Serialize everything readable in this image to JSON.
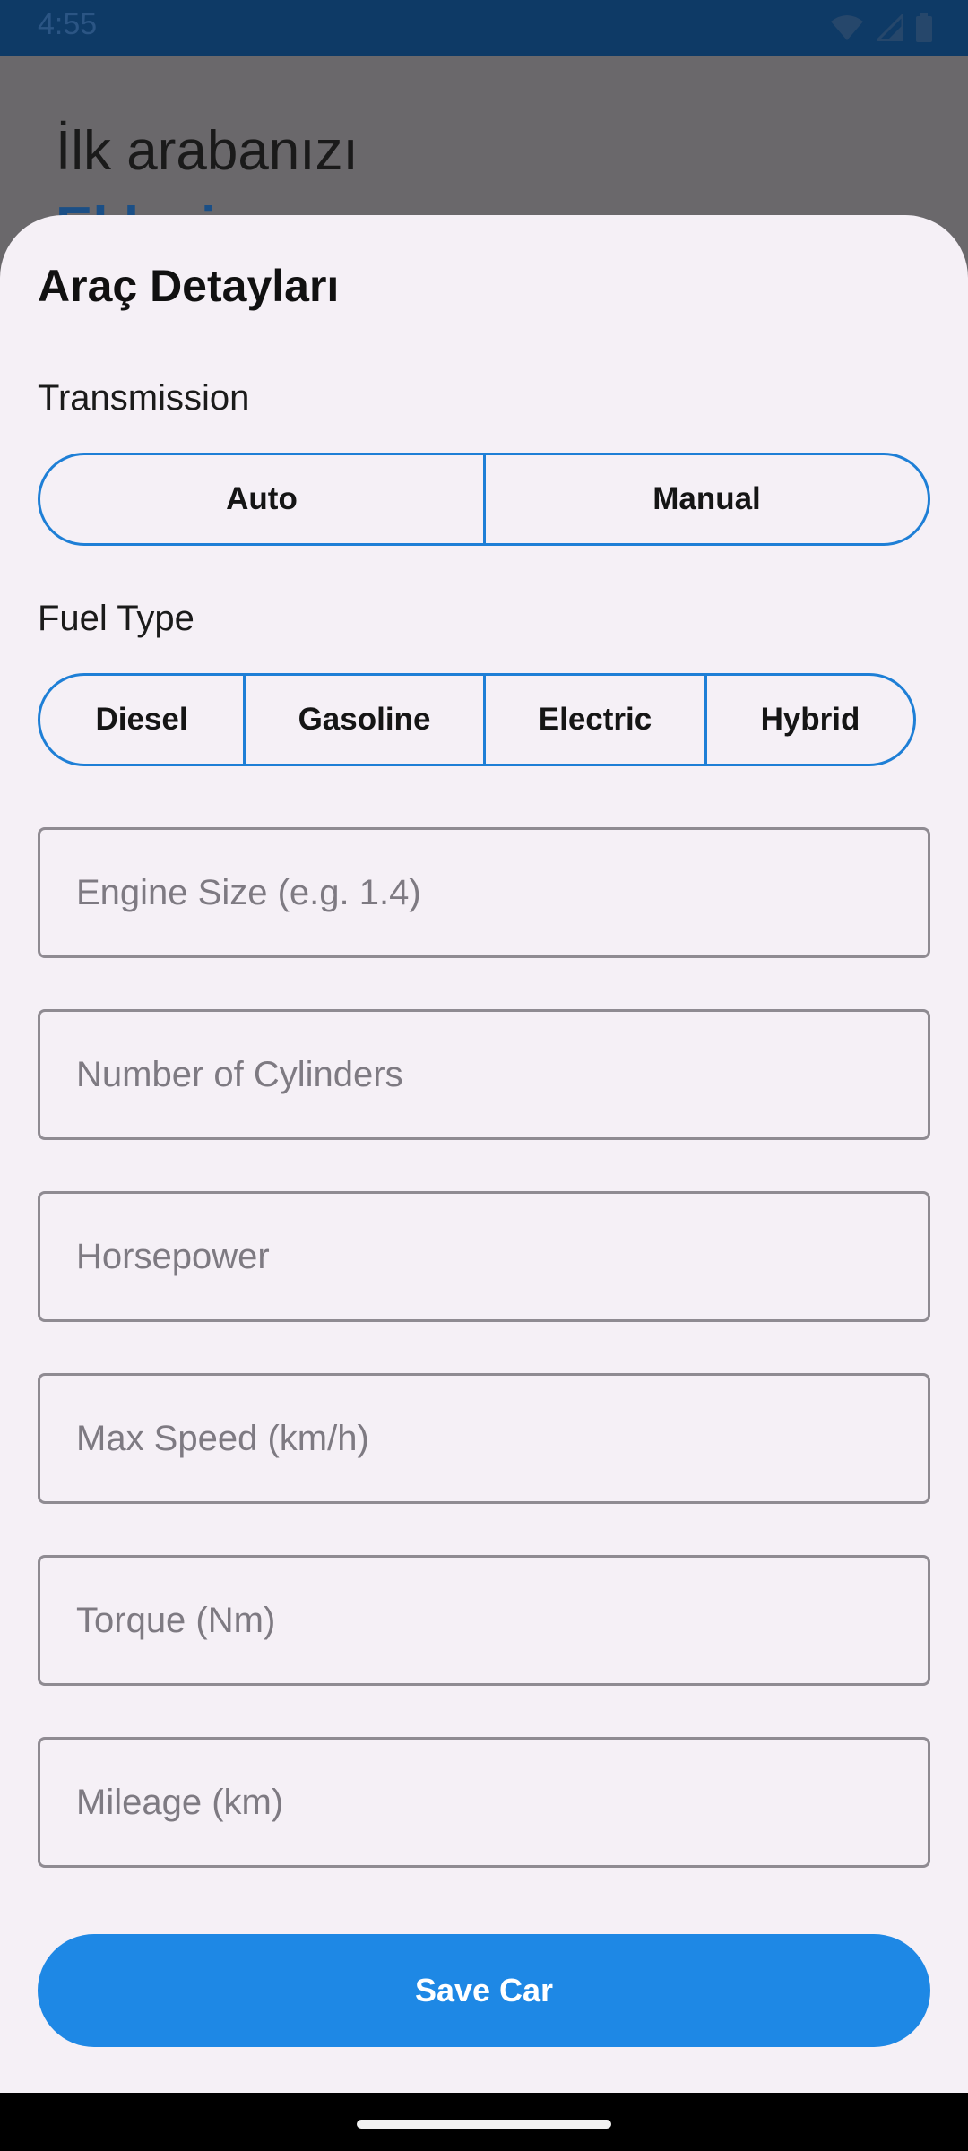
{
  "status_bar": {
    "time": "4:55",
    "icons": [
      "wifi-icon",
      "signal-icon",
      "battery-icon"
    ]
  },
  "background": {
    "greeting": "İlk arabanızı",
    "title": "Ekleyin"
  },
  "sheet": {
    "title": "Araç Detayları",
    "transmission": {
      "label": "Transmission",
      "options": [
        "Auto",
        "Manual"
      ]
    },
    "fuel_type": {
      "label": "Fuel Type",
      "options": [
        "Diesel",
        "Gasoline",
        "Electric",
        "Hybrid"
      ]
    },
    "fields": {
      "engine_size": "Engine Size (e.g. 1.4)",
      "cylinders": "Number of Cylinders",
      "horsepower": "Horsepower",
      "max_speed": "Max Speed (km/h)",
      "torque": "Torque (Nm)",
      "mileage": "Mileage (km)"
    },
    "save_label": "Save Car"
  },
  "colors": {
    "accent": "#1e88e5",
    "sheet_bg": "#f5f0f6",
    "status_bar": "#0e3a66"
  }
}
